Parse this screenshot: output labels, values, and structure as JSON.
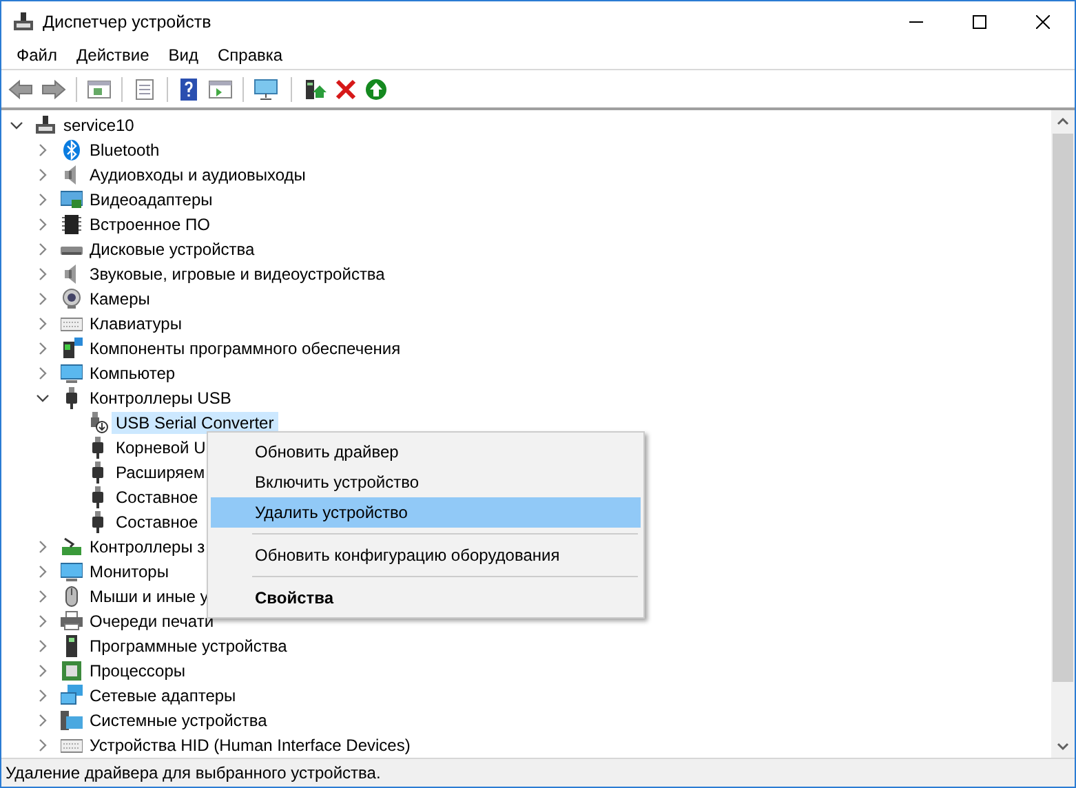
{
  "window": {
    "title": "Диспетчер устройств"
  },
  "menu": [
    "Файл",
    "Действие",
    "Вид",
    "Справка"
  ],
  "tree": [
    {
      "label": "service10",
      "expanded": true,
      "selected": false,
      "children": [
        {
          "label": "Bluetooth",
          "expanded": false,
          "selected": false
        },
        {
          "label": "Аудиовходы и аудиовыходы",
          "expanded": false,
          "selected": false
        },
        {
          "label": "Видеоадаптеры",
          "expanded": false,
          "selected": false
        },
        {
          "label": "Встроенное ПО",
          "expanded": false,
          "selected": false
        },
        {
          "label": "Дисковые устройства",
          "expanded": false,
          "selected": false
        },
        {
          "label": "Звуковые, игровые и видеоустройства",
          "expanded": false,
          "selected": false
        },
        {
          "label": "Камеры",
          "expanded": false,
          "selected": false
        },
        {
          "label": "Клавиатуры",
          "expanded": false,
          "selected": false
        },
        {
          "label": "Компоненты программного обеспечения",
          "expanded": false,
          "selected": false
        },
        {
          "label": "Компьютер",
          "expanded": false,
          "selected": false
        },
        {
          "label": "Контроллеры USB",
          "expanded": true,
          "selected": false,
          "children": [
            {
              "label": "USB Serial Converter",
              "selected": true
            },
            {
              "label": "Корневой U",
              "selected": false
            },
            {
              "label": "Расширяем",
              "selected": false
            },
            {
              "label": "Составное",
              "selected": false
            },
            {
              "label": "Составное",
              "selected": false
            }
          ]
        },
        {
          "label": "Контроллеры з",
          "expanded": false,
          "selected": false
        },
        {
          "label": "Мониторы",
          "expanded": false,
          "selected": false
        },
        {
          "label": "Мыши и иные у",
          "expanded": false,
          "selected": false
        },
        {
          "label": "Очереди печати",
          "expanded": false,
          "selected": false
        },
        {
          "label": "Программные устройства",
          "expanded": false,
          "selected": false
        },
        {
          "label": "Процессоры",
          "expanded": false,
          "selected": false
        },
        {
          "label": "Сетевые адаптеры",
          "expanded": false,
          "selected": false
        },
        {
          "label": "Системные устройства",
          "expanded": false,
          "selected": false
        },
        {
          "label": "Устройства HID (Human Interface Devices)",
          "expanded": false,
          "selected": false
        }
      ]
    }
  ],
  "context_menu": [
    {
      "kind": "item",
      "label": "Обновить драйвер",
      "selected": false
    },
    {
      "kind": "item",
      "label": "Включить устройство",
      "selected": false
    },
    {
      "kind": "item",
      "label": "Удалить устройство",
      "selected": true
    },
    {
      "kind": "separator"
    },
    {
      "kind": "item",
      "label": "Обновить конфигурацию оборудования",
      "selected": false
    },
    {
      "kind": "separator"
    },
    {
      "kind": "default",
      "label": "Свойства",
      "selected": false
    }
  ],
  "status_bar": "Удаление драйвера для выбранного устройства."
}
